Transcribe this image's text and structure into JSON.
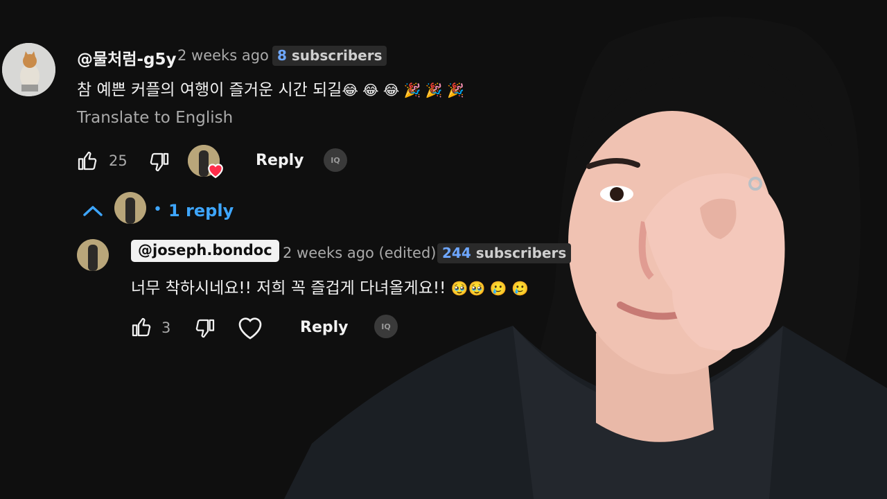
{
  "comment": {
    "handle": "@물처럼-g5y",
    "time": "2 weeks ago",
    "subscribers_count": "8",
    "subscribers_label": " subscribers",
    "text": "참 예쁜 커플의 여행이 즐거운 시간 되길",
    "emojis": "😂 😂 😂 🎉 🎉 🎉",
    "translate": "Translate to English",
    "likes": "25",
    "reply_label": "Reply",
    "iq_label": "IQ",
    "replies_label": "1 reply",
    "replies_dot": "•"
  },
  "reply": {
    "handle": "@joseph.bondoc",
    "time": "2 weeks ago (edited)",
    "subscribers_count": "244",
    "subscribers_label": " subscribers",
    "text": "너무 착하시네요!! 저희 꼭 즐겁게 다녀올게요!!",
    "emojis": "🥹🥹 🥲 🥲",
    "likes": "3",
    "reply_label": "Reply",
    "iq_label": "IQ"
  },
  "colors": {
    "background": "#0f0f0f",
    "link": "#3ea6ff",
    "heart": "#ff2d4a"
  },
  "icons": [
    "like-icon",
    "dislike-icon",
    "heart-icon",
    "chevron-up-icon",
    "iq-icon"
  ]
}
